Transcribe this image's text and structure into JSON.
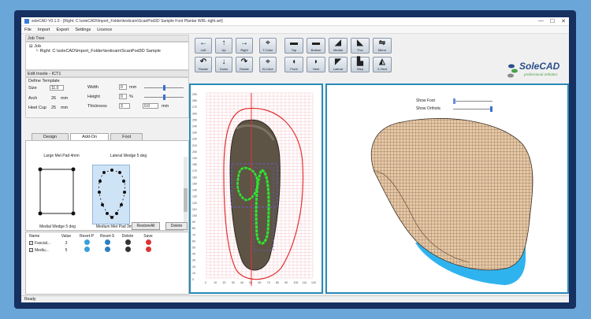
{
  "window": {
    "title": "soleCAD V0.1.0 - [Right: C:\\soleCAD\\Import_Folder\\texticam\\ScanPod3D Sample Foot Plantar WRL-right.wrl]",
    "controls": [
      "—",
      "☐",
      "✕"
    ]
  },
  "menu": [
    "File",
    "Import",
    "Export",
    "Settings",
    "Licence"
  ],
  "job_tree": {
    "header": "Job Tree",
    "root": "Job",
    "item": "Right: C:\\soleCAD\\Import_Folder\\texticam\\ScanPod3D Sample"
  },
  "edit_insole": {
    "header": "Edit Insole - ICT1",
    "define_template": "Define Template",
    "size_label": "Size",
    "size_value": "11.0",
    "arch_label": "Arch",
    "arch_value": "26",
    "arch_unit": "mm",
    "heel_cup_label": "Heel Cup",
    "heel_cup_value": "25",
    "heel_cup_unit": "mm",
    "width_label": "Width",
    "width_value": "0",
    "width_unit": "mm",
    "height_label": "Height",
    "height_value": "0",
    "height_unit": "%",
    "thickness_label": "Thickness",
    "thickness_value": "3",
    "thickness_value2": "0.0",
    "thickness_unit": "mm"
  },
  "tabs": [
    "Design",
    "Add-On",
    "Foot"
  ],
  "addons": {
    "pad1": "Large Met Pad 4mm",
    "pad2": "Lateral Wedge 5 deg",
    "pad3": "Medial Wedge 5 deg",
    "pad4": "Medium Met Pad 3mm"
  },
  "buttons": {
    "restore_all": "RestoreAll",
    "delete": "Delete"
  },
  "table": {
    "headers": [
      "Name",
      "Value",
      "Reset-P",
      "Reset-S",
      "Delete",
      "Save"
    ],
    "rows": [
      {
        "name": "Fascial...",
        "value": "3"
      },
      {
        "name": "Mediu...",
        "value": "5"
      }
    ]
  },
  "toolbar": {
    "row1": [
      "Left",
      "Up",
      "Right",
      "T-Color",
      "Top",
      "Bottom",
      "Medial",
      "Pos",
      "Mirror"
    ],
    "row2": [
      "Rotate",
      "Down",
      "Rotate",
      "B-Color",
      "Front",
      "Heel",
      "Lateral",
      "Step",
      "X-Sect"
    ]
  },
  "logo": {
    "brand": "SoleCAD",
    "tagline": "professional orthotics"
  },
  "view3d": {
    "show_foot": "Show Foot",
    "show_orthotic": "Show Orthotic"
  },
  "status": "Ready",
  "grid": {
    "y_ticks": [
      "290",
      "280",
      "270",
      "260",
      "250",
      "240",
      "230",
      "220",
      "210",
      "200",
      "190",
      "180",
      "170",
      "160",
      "150",
      "140",
      "130",
      "120",
      "110",
      "100",
      "90",
      "80",
      "70",
      "60",
      "50",
      "40",
      "30",
      "20",
      "10",
      "0"
    ],
    "x_ticks": [
      "0",
      "10",
      "20",
      "30",
      "40",
      "50",
      "60",
      "70",
      "80",
      "90",
      "100",
      "110",
      "120"
    ]
  }
}
